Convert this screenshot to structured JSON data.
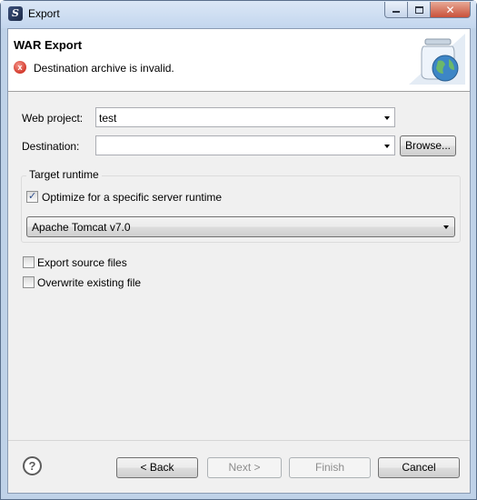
{
  "window": {
    "title": "Export",
    "close_symbol": "✕"
  },
  "banner": {
    "title": "WAR Export",
    "error_message": "Destination archive is invalid.",
    "error_icon": "x"
  },
  "form": {
    "web_project_label": "Web project:",
    "web_project_value": "test",
    "destination_label": "Destination:",
    "destination_value": "",
    "browse_label": "Browse..."
  },
  "target_runtime": {
    "group_title": "Target runtime",
    "optimize_label": "Optimize for a specific server runtime",
    "optimize_checked": true,
    "runtime_value": "Apache Tomcat v7.0"
  },
  "options": {
    "export_source_label": "Export source files",
    "export_source_checked": false,
    "overwrite_label": "Overwrite existing file",
    "overwrite_checked": false
  },
  "footer": {
    "help_symbol": "?",
    "back_label": "< Back",
    "next_label": "Next >",
    "finish_label": "Finish",
    "cancel_label": "Cancel"
  }
}
